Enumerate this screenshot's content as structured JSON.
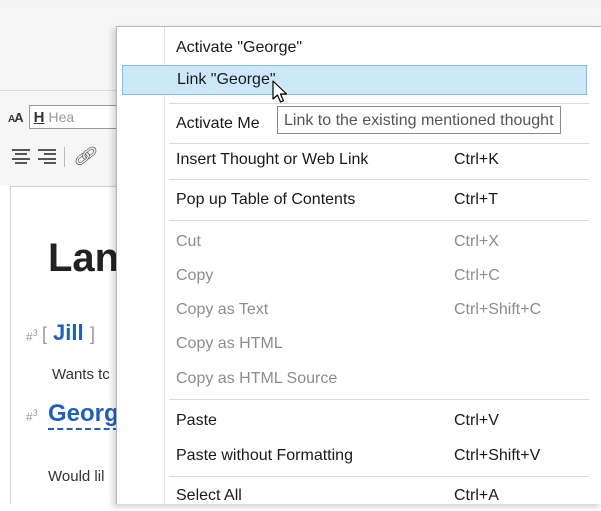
{
  "toolbar": {
    "font_size_label": "A",
    "heading_icon": "H",
    "heading_placeholder": "Hea"
  },
  "document": {
    "title": "Lan",
    "heading_marker": "#",
    "heading_level": "3",
    "entries": [
      {
        "name": "Jill",
        "body": "Wants tc"
      },
      {
        "name": "Georg",
        "body": "Would lil"
      }
    ]
  },
  "context_menu": {
    "items": [
      {
        "label": "Activate \"George\"",
        "shortcut": "",
        "disabled": false,
        "highlight": false
      },
      {
        "label": "Link \"George\"",
        "shortcut": "",
        "disabled": false,
        "highlight": true
      },
      {
        "label": "Activate Me",
        "shortcut": "",
        "disabled": false,
        "highlight": false
      },
      {
        "label": "Insert Thought or Web Link",
        "shortcut": "Ctrl+K",
        "disabled": false,
        "highlight": false
      },
      {
        "label": "Pop up Table of Contents",
        "shortcut": "Ctrl+T",
        "disabled": false,
        "highlight": false
      },
      {
        "label": "Cut",
        "shortcut": "Ctrl+X",
        "disabled": true,
        "highlight": false
      },
      {
        "label": "Copy",
        "shortcut": "Ctrl+C",
        "disabled": true,
        "highlight": false
      },
      {
        "label": "Copy as Text",
        "shortcut": "Ctrl+Shift+C",
        "disabled": true,
        "highlight": false
      },
      {
        "label": "Copy as HTML",
        "shortcut": "",
        "disabled": true,
        "highlight": false
      },
      {
        "label": "Copy as HTML Source",
        "shortcut": "",
        "disabled": true,
        "highlight": false
      },
      {
        "label": "Paste",
        "shortcut": "Ctrl+V",
        "disabled": false,
        "highlight": false
      },
      {
        "label": "Paste without Formatting",
        "shortcut": "Ctrl+Shift+V",
        "disabled": false,
        "highlight": false
      },
      {
        "label": "Select All",
        "shortcut": "Ctrl+A",
        "disabled": false,
        "highlight": false
      }
    ]
  },
  "tooltip": {
    "text": "Link to the existing mentioned thought"
  },
  "colors": {
    "highlight_bg": "#cce8f8",
    "highlight_border": "#7cc0e6",
    "link_blue": "#1f5fbf",
    "disabled_text": "#8d8d8d"
  }
}
